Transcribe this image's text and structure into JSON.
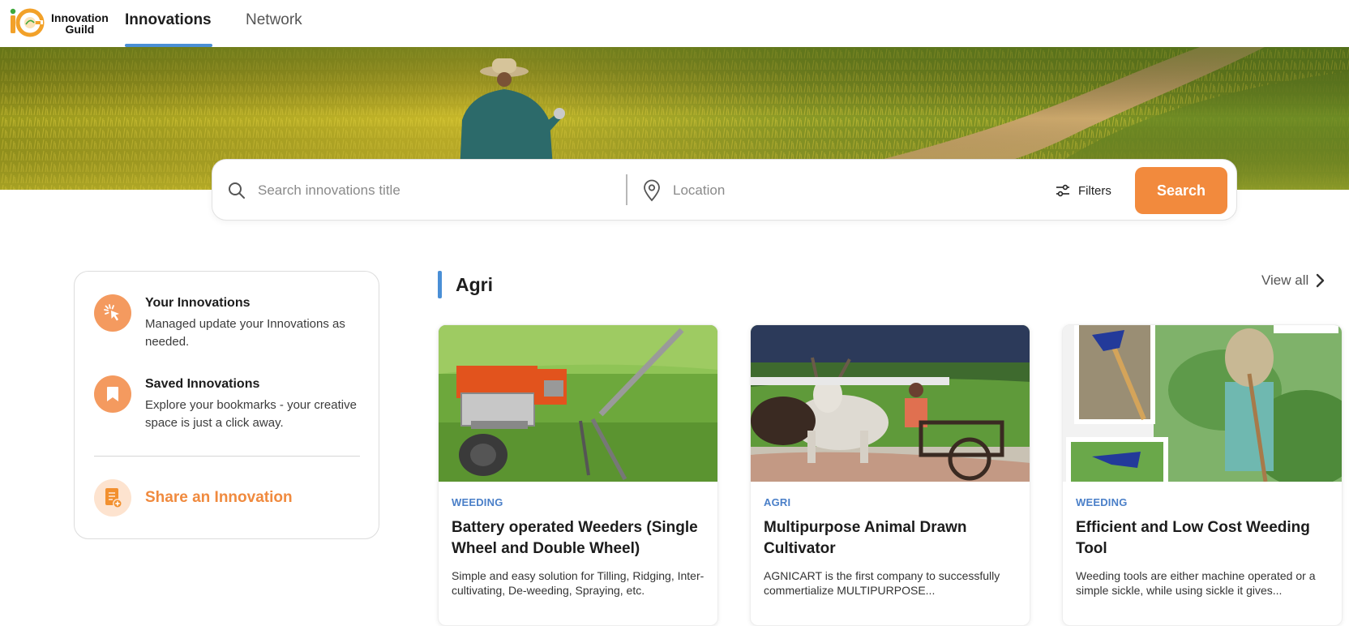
{
  "header": {
    "logo_line1": "Innovation",
    "logo_line2": "Guild",
    "tabs": [
      {
        "label": "Innovations",
        "active": true
      },
      {
        "label": "Network",
        "active": false
      }
    ]
  },
  "search": {
    "title_placeholder": "Search innovations title",
    "location_placeholder": "Location",
    "filters_label": "Filters",
    "button_label": "Search"
  },
  "sidebar": {
    "items": [
      {
        "title": "Your Innovations",
        "description": "Managed update your Innovations as needed.",
        "icon": "cursor-click-icon"
      },
      {
        "title": "Saved Innovations",
        "description": "Explore your bookmarks - your creative space is just a click away.",
        "icon": "bookmark-icon"
      }
    ],
    "share_label": "Share an Innovation",
    "share_icon": "document-add-icon"
  },
  "section": {
    "title": "Agri",
    "view_all": "View all"
  },
  "cards": [
    {
      "category": "WEEDING",
      "title": "Battery operated Weeders (Single Wheel and Double Wheel)",
      "description": "Simple and easy solution for Tilling, Ridging, Inter-cultivating, De-weeding, Spraying, etc."
    },
    {
      "category": "AGRI",
      "title": "Multipurpose Animal Drawn Cultivator",
      "description": "AGNICART is the first company to successfully commertialize MULTIPURPOSE..."
    },
    {
      "category": "WEEDING",
      "title": "Efficient and Low Cost Weeding Tool",
      "description": "Weeding tools are either machine operated or a simple sickle, while using sickle it gives..."
    }
  ],
  "colors": {
    "accent_orange": "#f28a3d",
    "accent_blue": "#4a8fd6",
    "category_blue": "#4a7fc8"
  }
}
